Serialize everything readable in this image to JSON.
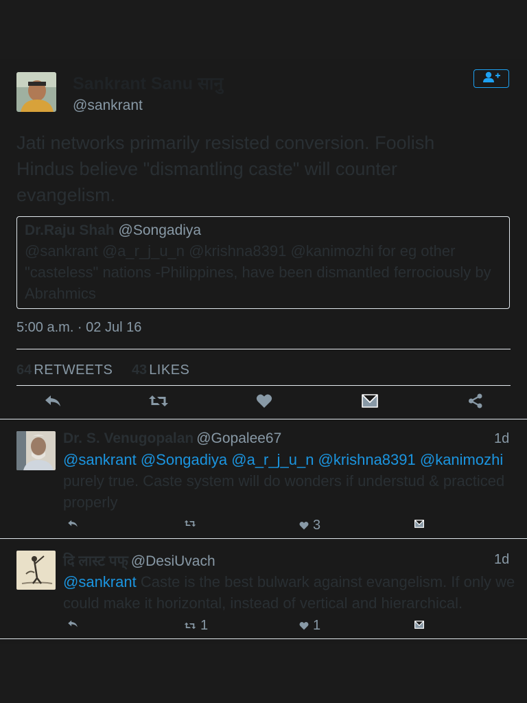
{
  "tweet": {
    "author_name": "Sankrant Sanu सानु",
    "author_handle": "@sankrant",
    "text": "Jati networks primarily resisted conversion. Foolish Hindus believe \"dismantling caste\" will counter evangelism.",
    "quote": {
      "name": "Dr.Raju Shah",
      "handle": "@Songadiya",
      "text": "@sankrant @a_r_j_u_n @krishna8391 @kanimozhi for eg other \"casteless\" nations -Philippines, have been dismantled ferrociously by Abrahmics"
    },
    "timestamp": "5:00 a.m. · 02 Jul 16",
    "retweets_count": "64",
    "retweets_label": "RETWEETS",
    "likes_count": "43",
    "likes_label": "LIKES"
  },
  "actions": [
    {
      "name": "reply-icon"
    },
    {
      "name": "retweet-icon"
    },
    {
      "name": "like-icon"
    },
    {
      "name": "direct-message-icon"
    },
    {
      "name": "share-icon"
    }
  ],
  "replies": [
    {
      "name": "Dr. S. Venugopalan",
      "handle": "@Gopalee67",
      "time": "1d",
      "mentions": "@sankrant @Songadiya @a_r_j_u_n @krishna8391 @kanimozhi",
      "text": "purely true. Caste system will do wonders if understud & practiced  properly",
      "retweets": "",
      "likes": "3"
    },
    {
      "name": "दि लास्ट पफ्",
      "handle": "@DesiUvach",
      "time": "1d",
      "mentions": "@sankrant",
      "text": "Caste is the best bulwark against evangelism. If only we could make it horizontal, instead of vertical and hierarchical.",
      "retweets": "1",
      "likes": "1"
    }
  ],
  "colors": {
    "accent": "#1da1f2",
    "mention": "#1b95e0",
    "muted": "#8899a6",
    "text": "#292f33"
  }
}
